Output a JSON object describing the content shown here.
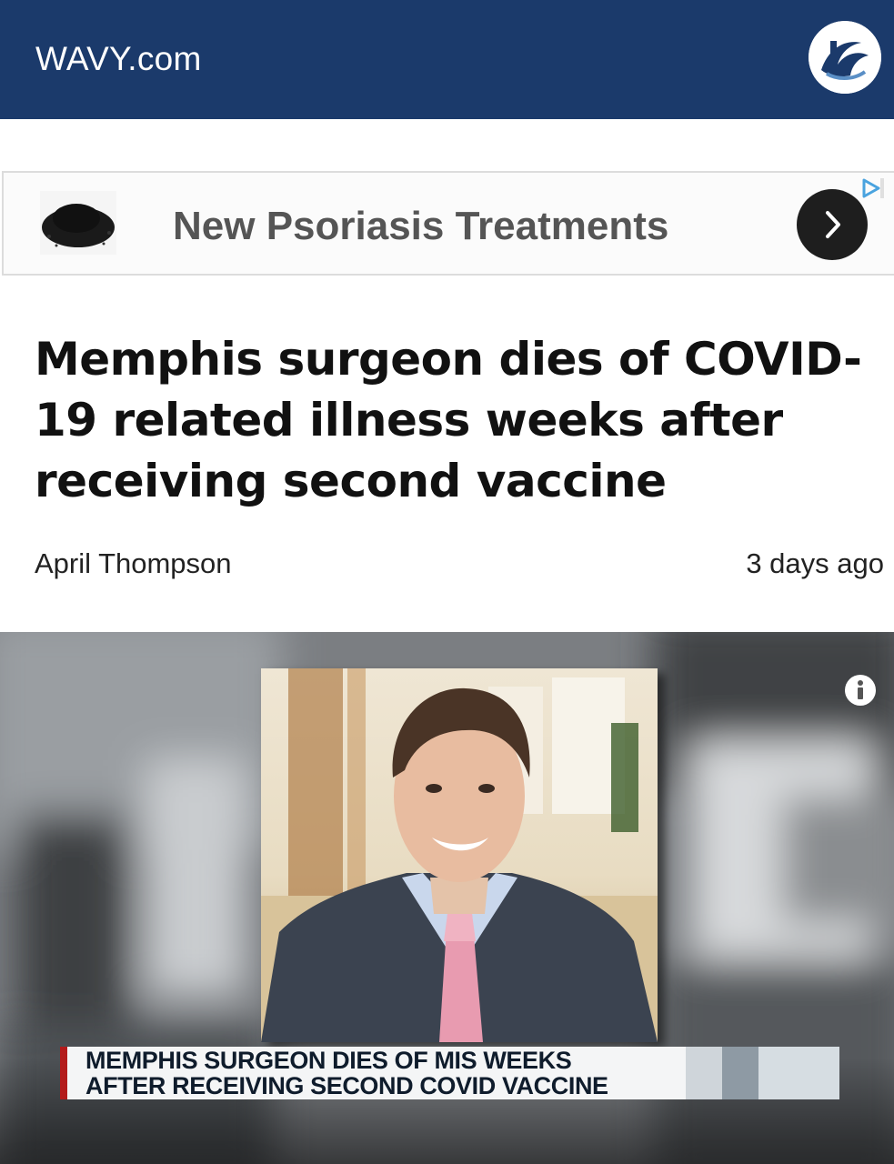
{
  "header": {
    "site_name": "WAVY.com",
    "logo_icon": "wavy-logo-icon",
    "background_color": "#1b3a6b"
  },
  "ad": {
    "text": "New Psoriasis Treatments",
    "arrow_icon": "chevron-right-icon",
    "badge_icon": "adchoices-icon"
  },
  "article": {
    "headline": "Memphis surgeon dies of COVID-19 related illness weeks after receiving second vaccine",
    "author": "April Thompson",
    "time": "3 days ago"
  },
  "media": {
    "info_icon": "info-icon",
    "lower_third_line1": "MEMPHIS SURGEON DIES OF MIS WEEKS",
    "lower_third_line2": "AFTER RECEIVING SECOND COVID VACCINE",
    "accent_color": "#b31b1b"
  }
}
